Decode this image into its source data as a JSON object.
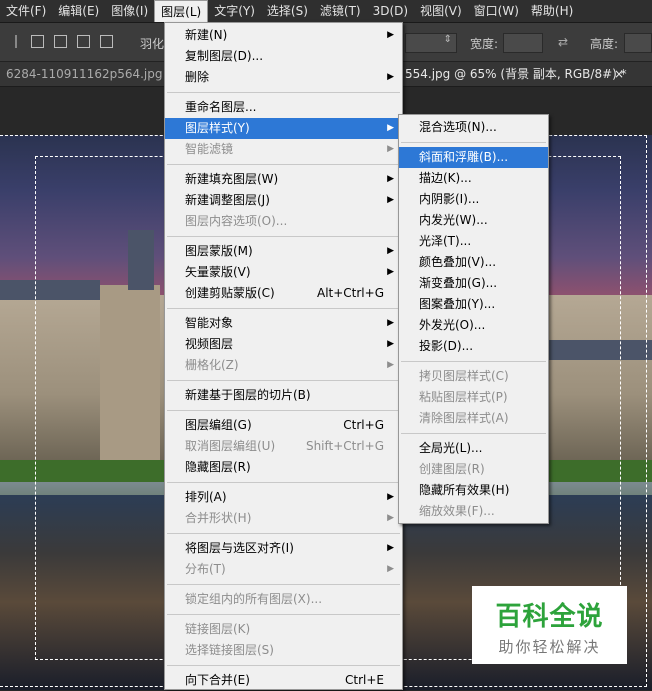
{
  "menubar": [
    {
      "label": "文件(F)",
      "active": false
    },
    {
      "label": "编辑(E)",
      "active": false
    },
    {
      "label": "图像(I)",
      "active": false
    },
    {
      "label": "图层(L)",
      "active": true
    },
    {
      "label": "文字(Y)",
      "active": false
    },
    {
      "label": "选择(S)",
      "active": false
    },
    {
      "label": "滤镜(T)",
      "active": false
    },
    {
      "label": "3D(D)",
      "active": false
    },
    {
      "label": "视图(V)",
      "active": false
    },
    {
      "label": "窗口(W)",
      "active": false
    },
    {
      "label": "帮助(H)",
      "active": false
    }
  ],
  "options": {
    "feather": "羽化",
    "width": "宽度:",
    "height": "高度:"
  },
  "tabs": {
    "left": "6284-110911162p564.jpg @ 6",
    "right": "554.jpg @ 65% (背景 副本, RGB/8#) *",
    "close": "×"
  },
  "layer_menu": [
    {
      "label": "新建(N)",
      "submenu": true
    },
    {
      "label": "复制图层(D)..."
    },
    {
      "label": "删除",
      "submenu": true
    },
    {
      "sep": true
    },
    {
      "label": "重命名图层..."
    },
    {
      "label": "图层样式(Y)",
      "submenu": true,
      "highlight": true
    },
    {
      "label": "智能滤镜",
      "submenu": true,
      "disabled": true
    },
    {
      "sep": true
    },
    {
      "label": "新建填充图层(W)",
      "submenu": true
    },
    {
      "label": "新建调整图层(J)",
      "submenu": true
    },
    {
      "label": "图层内容选项(O)...",
      "disabled": true
    },
    {
      "sep": true
    },
    {
      "label": "图层蒙版(M)",
      "submenu": true
    },
    {
      "label": "矢量蒙版(V)",
      "submenu": true
    },
    {
      "label": "创建剪贴蒙版(C)",
      "shortcut": "Alt+Ctrl+G"
    },
    {
      "sep": true
    },
    {
      "label": "智能对象",
      "submenu": true
    },
    {
      "label": "视频图层",
      "submenu": true
    },
    {
      "label": "栅格化(Z)",
      "submenu": true,
      "disabled": true
    },
    {
      "sep": true
    },
    {
      "label": "新建基于图层的切片(B)"
    },
    {
      "sep": true
    },
    {
      "label": "图层编组(G)",
      "shortcut": "Ctrl+G"
    },
    {
      "label": "取消图层编组(U)",
      "shortcut": "Shift+Ctrl+G",
      "disabled": true
    },
    {
      "label": "隐藏图层(R)"
    },
    {
      "sep": true
    },
    {
      "label": "排列(A)",
      "submenu": true
    },
    {
      "label": "合并形状(H)",
      "submenu": true,
      "disabled": true
    },
    {
      "sep": true
    },
    {
      "label": "将图层与选区对齐(I)",
      "submenu": true
    },
    {
      "label": "分布(T)",
      "submenu": true,
      "disabled": true
    },
    {
      "sep": true
    },
    {
      "label": "锁定组内的所有图层(X)...",
      "disabled": true
    },
    {
      "sep": true
    },
    {
      "label": "链接图层(K)",
      "disabled": true
    },
    {
      "label": "选择链接图层(S)",
      "disabled": true
    },
    {
      "sep": true
    },
    {
      "label": "向下合并(E)",
      "shortcut": "Ctrl+E"
    }
  ],
  "style_submenu": [
    {
      "label": "混合选项(N)..."
    },
    {
      "sep": true
    },
    {
      "label": "斜面和浮雕(B)...",
      "highlight": true
    },
    {
      "label": "描边(K)..."
    },
    {
      "label": "内阴影(I)..."
    },
    {
      "label": "内发光(W)..."
    },
    {
      "label": "光泽(T)..."
    },
    {
      "label": "颜色叠加(V)..."
    },
    {
      "label": "渐变叠加(G)..."
    },
    {
      "label": "图案叠加(Y)..."
    },
    {
      "label": "外发光(O)..."
    },
    {
      "label": "投影(D)..."
    },
    {
      "sep": true
    },
    {
      "label": "拷贝图层样式(C)",
      "disabled": true
    },
    {
      "label": "粘贴图层样式(P)",
      "disabled": true
    },
    {
      "label": "清除图层样式(A)",
      "disabled": true
    },
    {
      "sep": true
    },
    {
      "label": "全局光(L)..."
    },
    {
      "label": "创建图层(R)",
      "disabled": true
    },
    {
      "label": "隐藏所有效果(H)"
    },
    {
      "label": "缩放效果(F)...",
      "disabled": true
    }
  ],
  "watermark": {
    "title": "百科全说",
    "subtitle": "助你轻松解决"
  },
  "arrow_glyph": "▶"
}
